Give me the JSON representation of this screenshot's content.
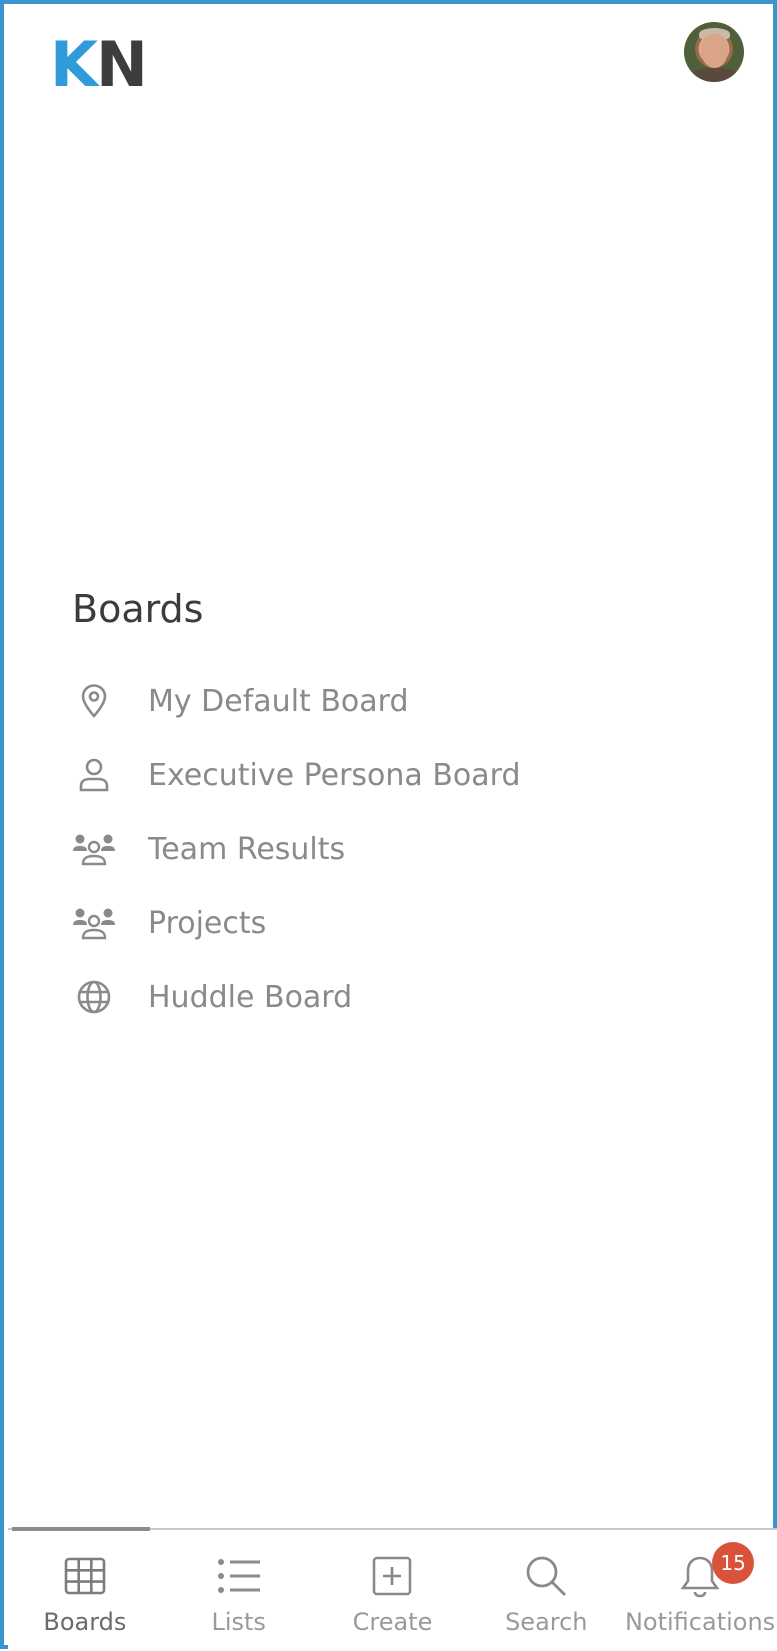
{
  "header": {
    "logo_k": "K",
    "logo_n": "N",
    "logo_colors": {
      "k": "#2f9bd8",
      "n": "#3d3d3d"
    },
    "avatar_icon": "user-avatar-photo"
  },
  "boards": {
    "title": "Boards",
    "items": [
      {
        "label": "My Default Board",
        "icon": "map-pin-icon"
      },
      {
        "label": "Executive Persona Board",
        "icon": "person-icon"
      },
      {
        "label": "Team Results",
        "icon": "team-icon"
      },
      {
        "label": "Projects",
        "icon": "team-icon"
      },
      {
        "label": "Huddle Board",
        "icon": "globe-icon"
      }
    ]
  },
  "bottom_nav": {
    "active": "Boards",
    "items": [
      {
        "label": "Boards",
        "icon": "grid-icon"
      },
      {
        "label": "Lists",
        "icon": "list-icon"
      },
      {
        "label": "Create",
        "icon": "plus-square-icon"
      },
      {
        "label": "Search",
        "icon": "search-icon"
      },
      {
        "label": "Notifications",
        "icon": "bell-icon",
        "badge": "15"
      }
    ]
  },
  "colors": {
    "frame_border": "#3a95cf",
    "badge": "#d9533b"
  }
}
